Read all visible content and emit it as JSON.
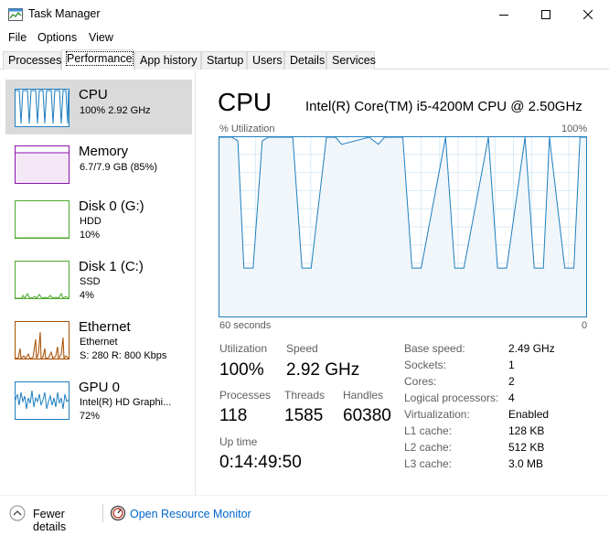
{
  "window": {
    "title": "Task Manager",
    "icons": {
      "app": "task-manager-icon",
      "minimize": "minimize-icon",
      "maximize": "maximize-icon",
      "close": "close-icon"
    }
  },
  "menu": {
    "file": "File",
    "options": "Options",
    "view": "View"
  },
  "tabs": [
    "Processes",
    "Performance",
    "App history",
    "Startup",
    "Users",
    "Details",
    "Services"
  ],
  "active_tab": "Performance",
  "sidebar": {
    "items": [
      {
        "title": "CPU",
        "line1": "100%  2.92 GHz",
        "line2": "",
        "color": "#1e7fc0",
        "util_level": 1.0
      },
      {
        "title": "Memory",
        "line1": "6.7/7.9 GB (85%)",
        "line2": "",
        "color": "#8b12ae",
        "util_level": 0.85
      },
      {
        "title": "Disk 0 (G:)",
        "line1": "HDD",
        "line2": "10%",
        "color": "#4ca82a",
        "util_level": 0.1
      },
      {
        "title": "Disk 1 (C:)",
        "line1": "SSD",
        "line2": "4%",
        "color": "#4ca82a",
        "util_level": 0.04
      },
      {
        "title": "Ethernet",
        "line1": "Ethernet",
        "line2": "S: 280  R: 800 Kbps",
        "color": "#a74f01",
        "util_level": 0.5
      },
      {
        "title": "GPU 0",
        "line1": "Intel(R) HD Graphi...",
        "line2": "72%",
        "color": "#1e7fc0",
        "util_level": 0.72
      }
    ]
  },
  "main": {
    "title": "CPU",
    "model": "Intel(R) Core(TM) i5-4200M CPU @ 2.50GHz",
    "graph": {
      "y_label": "% Utilization",
      "y_max_label": "100%",
      "x_label": "60 seconds",
      "x_min_label": "0",
      "line_color": "#1e7fc0",
      "fill_color": "#f1f6fa",
      "grid_color": "#d9eaf4"
    },
    "stats": {
      "utilization_label": "Utilization",
      "utilization": "100%",
      "speed_label": "Speed",
      "speed": "2.92 GHz",
      "processes_label": "Processes",
      "processes": "118",
      "threads_label": "Threads",
      "threads": "1585",
      "handles_label": "Handles",
      "handles": "60380",
      "uptime_label": "Up time",
      "uptime": "0:14:49:50"
    },
    "specs": [
      {
        "label": "Base speed:",
        "value": "2.49 GHz"
      },
      {
        "label": "Sockets:",
        "value": "1"
      },
      {
        "label": "Cores:",
        "value": "2"
      },
      {
        "label": "Logical processors:",
        "value": "4"
      },
      {
        "label": "Virtualization:",
        "value": "Enabled"
      },
      {
        "label": "L1 cache:",
        "value": "128 KB"
      },
      {
        "label": "L2 cache:",
        "value": "512 KB"
      },
      {
        "label": "L3 cache:",
        "value": "3.0 MB"
      }
    ]
  },
  "footer": {
    "fewer_details": "Fewer details",
    "resource_monitor": "Open Resource Monitor",
    "icons": {
      "collapse": "chevron-up-icon",
      "monitor": "resource-monitor-icon"
    }
  },
  "chart_data": {
    "type": "line",
    "title": "% Utilization",
    "xlabel": "60 seconds",
    "ylabel": "% Utilization",
    "ylim": [
      0,
      100
    ],
    "xlim": [
      60,
      0
    ],
    "series": [
      {
        "x": [
          60,
          58,
          57,
          56,
          54.5,
          53,
          52,
          51,
          48,
          46.5,
          45,
          42.5,
          41,
          40,
          35.5,
          34,
          33,
          30,
          28.5,
          27,
          23,
          21.5,
          20,
          16,
          14.5,
          13,
          10,
          8.5,
          7,
          6,
          3.5,
          2,
          1,
          0
        ],
        "values": [
          100,
          100,
          98,
          27,
          27,
          98,
          100,
          100,
          100,
          27,
          27,
          100,
          100,
          96,
          100,
          96,
          100,
          100,
          27,
          27,
          100,
          27,
          27,
          100,
          27,
          27,
          100,
          27,
          27,
          100,
          27,
          27,
          100,
          100
        ]
      }
    ]
  }
}
